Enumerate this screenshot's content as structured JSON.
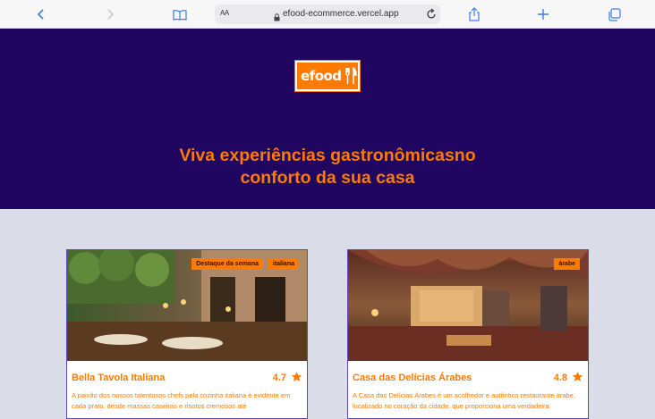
{
  "browser": {
    "aa_label": "AA",
    "url": "efood-ecommerce.vercel.app"
  },
  "header": {
    "logo_text": "efood",
    "hero_title": "Viva experiências gastronômicasno conforto da sua casa"
  },
  "restaurants": [
    {
      "name": "Bella Tavola Italiana",
      "rating": "4.7",
      "tags": [
        "Destaque da semana",
        "italiana"
      ],
      "description": "A paixão dos nossos talentosos chefs pela cozinha italiana é evidente em cada prato, desde massas caseiras e risotos cremosos até"
    },
    {
      "name": "Casa das Delícias Árabes",
      "rating": "4.8",
      "tags": [
        "árabe"
      ],
      "description": "A Casa das Delícias Árabes é um acolhedor e autêntico restaurante árabe, localizado no coração da cidade, que proporciona uma verdadeira"
    }
  ],
  "colors": {
    "brand_orange": "#ff7a00",
    "hero_bg": "#200561",
    "page_bg": "#dadce8"
  }
}
